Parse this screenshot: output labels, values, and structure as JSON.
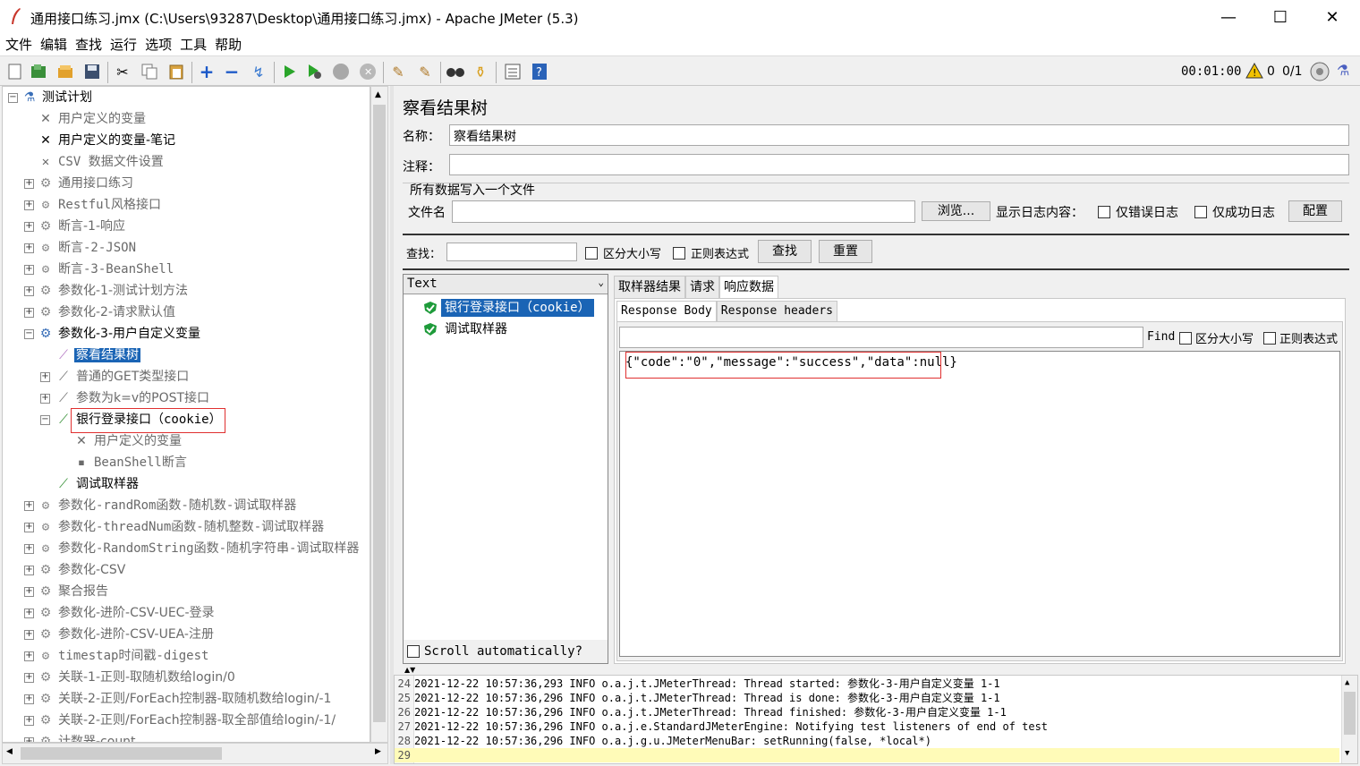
{
  "window": {
    "title": "通用接口练习.jmx (C:\\Users\\93287\\Desktop\\通用接口练习.jmx) - Apache JMeter (5.3)",
    "minimize": "—",
    "maximize": "☐",
    "close": "✕"
  },
  "menu": [
    "文件",
    "编辑",
    "查找",
    "运行",
    "选项",
    "工具",
    "帮助"
  ],
  "toolbar": {
    "timer": "00:01:00",
    "warnings": "0",
    "threads": "0/1"
  },
  "tree": {
    "root": "测试计划",
    "items": [
      "用户定义的变量",
      "用户定义的变量-笔记",
      "CSV 数据文件设置",
      "通用接口练习",
      "Restful风格接口",
      "断言-1-响应",
      "断言-2-JSON",
      "断言-3-BeanShell",
      "参数化-1-测试计划方法",
      "参数化-2-请求默认值",
      "参数化-3-用户自定义变量",
      "察看结果树",
      "普通的GET类型接口",
      "参数为k=v的POST接口",
      "银行登录接口（cookie）",
      "用户定义的变量",
      "BeanShell断言",
      "调试取样器",
      "参数化-randRom函数-随机数-调试取样器",
      "参数化-threadNum函数-随机整数-调试取样器",
      "参数化-RandomString函数-随机字符串-调试取样器",
      "参数化-CSV",
      "聚合报告",
      "参数化-进阶-CSV-UEC-登录",
      "参数化-进阶-CSV-UEA-注册",
      "timestap时间戳-digest",
      "关联-1-正则-取随机数给login/0",
      "关联-2-正则/ForEach控制器-取随机数给login/-1",
      "关联-2-正则/ForEach控制器-取全部值给login/-1/",
      "计数器-count"
    ]
  },
  "panel": {
    "heading": "察看结果树",
    "name_label": "名称：",
    "name_value": "察看结果树",
    "comment_label": "注释：",
    "comment_value": "",
    "file_section": "所有数据写入一个文件",
    "filename_label": "文件名",
    "filename_value": "",
    "browse": "浏览...",
    "log_content_label": "显示日志内容：",
    "errors_only": "仅错误日志",
    "success_only": "仅成功日志",
    "configure": "配置",
    "search_label": "查找：",
    "search_value": "",
    "case_sensitive": "区分大小写",
    "regex": "正则表达式",
    "find_btn": "查找",
    "reset_btn": "重置",
    "renderer": "Text",
    "results": [
      "银行登录接口（cookie）",
      "调试取样器"
    ],
    "scroll_auto": "Scroll automatically?",
    "tabs": [
      "取样器结果",
      "请求",
      "响应数据"
    ],
    "subtabs": [
      "Response Body",
      "Response headers"
    ],
    "find_label": "Find",
    "find_case": "区分大小写",
    "find_regex": "正则表达式",
    "response_body": "{\"code\":\"0\",\"message\":\"success\",\"data\":null}"
  },
  "log": [
    {
      "n": "24",
      "text": "2021-12-22 10:57:36,293 INFO o.a.j.t.JMeterThread: Thread started: 参数化-3-用户自定义变量 1-1"
    },
    {
      "n": "25",
      "text": "2021-12-22 10:57:36,296 INFO o.a.j.t.JMeterThread: Thread is done: 参数化-3-用户自定义变量 1-1"
    },
    {
      "n": "26",
      "text": "2021-12-22 10:57:36,296 INFO o.a.j.t.JMeterThread: Thread finished: 参数化-3-用户自定义变量 1-1"
    },
    {
      "n": "27",
      "text": "2021-12-22 10:57:36,296 INFO o.a.j.e.StandardJMeterEngine: Notifying test listeners of end of test"
    },
    {
      "n": "28",
      "text": "2021-12-22 10:57:36,296 INFO o.a.j.g.u.JMeterMenuBar: setRunning(false, *local*)"
    },
    {
      "n": "29",
      "text": ""
    }
  ]
}
